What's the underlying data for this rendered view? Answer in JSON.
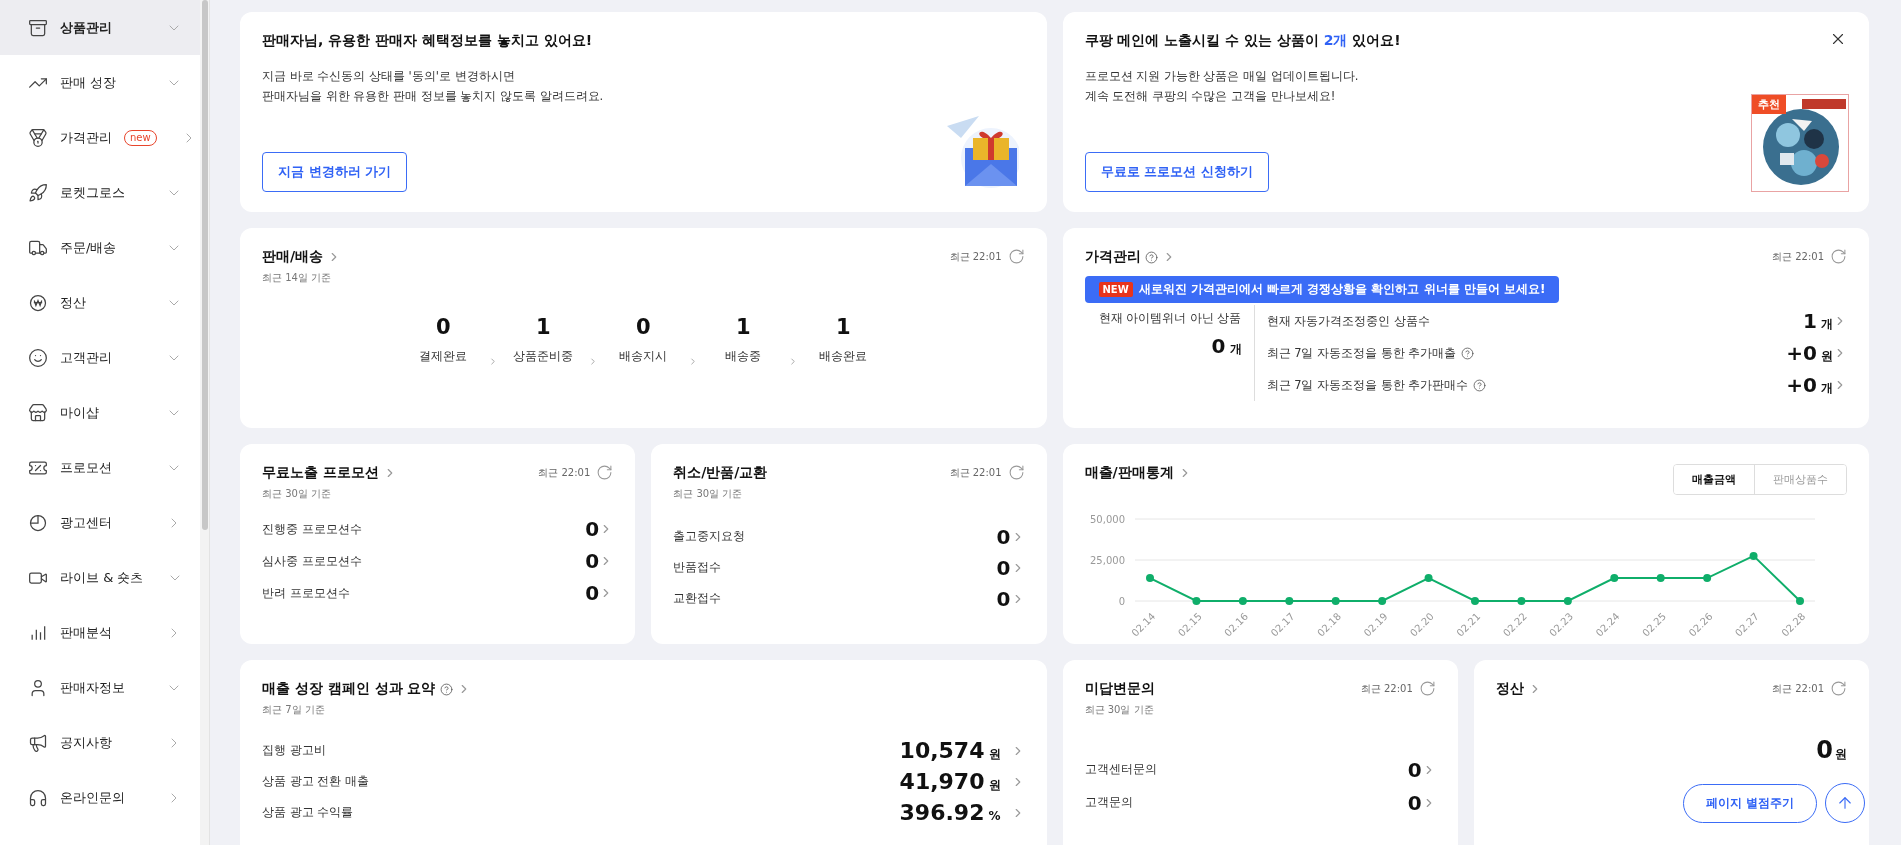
{
  "sidebar": {
    "items": [
      {
        "label": "상품관리",
        "expandable": true,
        "selected": true
      },
      {
        "label": "판매 성장",
        "expandable": true,
        "selected": false
      },
      {
        "label": "가격관리",
        "expandable": false,
        "selected": false,
        "badge": "new"
      },
      {
        "label": "로켓그로스",
        "expandable": true,
        "selected": false
      },
      {
        "label": "주문/배송",
        "expandable": true,
        "selected": false
      },
      {
        "label": "정산",
        "expandable": true,
        "selected": false
      },
      {
        "label": "고객관리",
        "expandable": true,
        "selected": false
      },
      {
        "label": "마이샵",
        "expandable": true,
        "selected": false
      },
      {
        "label": "프로모션",
        "expandable": true,
        "selected": false
      },
      {
        "label": "광고센터",
        "expandable": false,
        "selected": false
      },
      {
        "label": "라이브 & 숏츠",
        "expandable": true,
        "selected": false
      },
      {
        "label": "판매분석",
        "expandable": false,
        "selected": false
      },
      {
        "label": "판매자정보",
        "expandable": true,
        "selected": false
      },
      {
        "label": "공지사항",
        "expandable": false,
        "selected": false
      },
      {
        "label": "온라인문의",
        "expandable": false,
        "selected": false
      }
    ]
  },
  "benefit_banner": {
    "title": "판매자님, 유용한 판매자 혜택정보를 놓치고 있어요!",
    "lines": [
      "지금 바로 수신동의 상태를 '동의'로 변경하시면",
      "판매자님을 위한 유용한 판매 정보를 놓치지 않도록 알려드려요."
    ],
    "button": "지금 변경하러 가기"
  },
  "promo_banner": {
    "title_before": "쿠팡 메인에 노출시킬 수 있는 상품이 ",
    "title_highlight": "2개",
    "title_after": " 있어요!",
    "lines": [
      "프로모션 지원 가능한 상품은 매일 업데이트됩니다.",
      "계속 도전해 쿠팡의 수많은 고객을 만나보세요!"
    ],
    "button": "무료로 프로모션 신청하기",
    "thumbnail_badge": "추천"
  },
  "sales_delivery": {
    "title": "판매/배송",
    "subtitle": "최근 14일 기준",
    "updated": "최근 22:01",
    "steps": [
      {
        "count": "0",
        "label": "결제완료"
      },
      {
        "count": "1",
        "label": "상품준비중"
      },
      {
        "count": "0",
        "label": "배송지시"
      },
      {
        "count": "1",
        "label": "배송중"
      },
      {
        "count": "1",
        "label": "배송완료"
      }
    ]
  },
  "price_management": {
    "title": "가격관리",
    "updated": "최근 22:01",
    "notice_badge": "NEW",
    "notice": "새로워진 가격관리에서 빠르게 경쟁상황을 확인하고 위너를 만들어 보세요!",
    "left_label": "현재 아이템위너 아닌 상품",
    "left_value": "0",
    "left_unit": "개",
    "rows": [
      {
        "label": "현재 자동가격조정중인 상품수",
        "value": "1",
        "unit": "개",
        "help": false
      },
      {
        "label": "최근 7일 자동조정을 통한 추가매출",
        "value": "+0",
        "unit": "원",
        "help": true
      },
      {
        "label": "최근 7일 자동조정을 통한 추가판매수",
        "value": "+0",
        "unit": "개",
        "help": true
      }
    ]
  },
  "free_promotion": {
    "title": "무료노출 프로모션",
    "subtitle": "최근 30일 기준",
    "updated": "최근 22:01",
    "rows": [
      {
        "label": "진행중 프로모션수",
        "value": "0"
      },
      {
        "label": "심사중 프로모션수",
        "value": "0"
      },
      {
        "label": "반려 프로모션수",
        "value": "0"
      }
    ]
  },
  "cancel_return": {
    "title": "취소/반품/교환",
    "subtitle": "최근 30일 기준",
    "updated": "최근 22:01",
    "rows": [
      {
        "label": "출고중지요청",
        "value": "0"
      },
      {
        "label": "반품접수",
        "value": "0"
      },
      {
        "label": "교환접수",
        "value": "0"
      }
    ]
  },
  "sales_stats": {
    "title": "매출/판매통계",
    "toggles": [
      {
        "label": "매출금액",
        "selected": true
      },
      {
        "label": "판매상품수",
        "selected": false
      }
    ],
    "chart_data": {
      "type": "line",
      "categories": [
        "02.14",
        "02.15",
        "02.16",
        "02.17",
        "02.18",
        "02.19",
        "02.20",
        "02.21",
        "02.22",
        "02.23",
        "02.24",
        "02.25",
        "02.26",
        "02.27",
        "02.28"
      ],
      "series": [
        {
          "color": "#0fae6a",
          "marker": "circle",
          "values": [
            14000,
            0,
            0,
            0,
            0,
            0,
            14000,
            0,
            0,
            0,
            14000,
            14000,
            14000,
            27500,
            0
          ]
        }
      ],
      "ylim": [
        0,
        50000
      ],
      "yticks": [
        {
          "value": 0,
          "label": "0"
        },
        {
          "value": 25000,
          "label": "25,000"
        },
        {
          "value": 50000,
          "label": "50,000"
        }
      ]
    }
  },
  "campaign": {
    "title": "매출 성장 캠페인 성과 요약",
    "subtitle": "최근 7일 기준",
    "rows": [
      {
        "label": "집행 광고비",
        "value": "10,574",
        "unit": "원"
      },
      {
        "label": "상품 광고 전환 매출",
        "value": "41,970",
        "unit": "원"
      },
      {
        "label": "상품 광고 수익률",
        "value": "396.92",
        "unit": "%"
      }
    ]
  },
  "unanswered": {
    "title": "미답변문의",
    "subtitle": "최근 30일 기준",
    "updated": "최근 22:01",
    "rows": [
      {
        "label": "고객센터문의",
        "value": "0"
      },
      {
        "label": "고객문의",
        "value": "0"
      }
    ]
  },
  "settlement": {
    "title": "정산",
    "updated": "최근 22:01",
    "value": "0",
    "unit": "원"
  },
  "floating": {
    "rate_button": "페이지 별점주기"
  }
}
